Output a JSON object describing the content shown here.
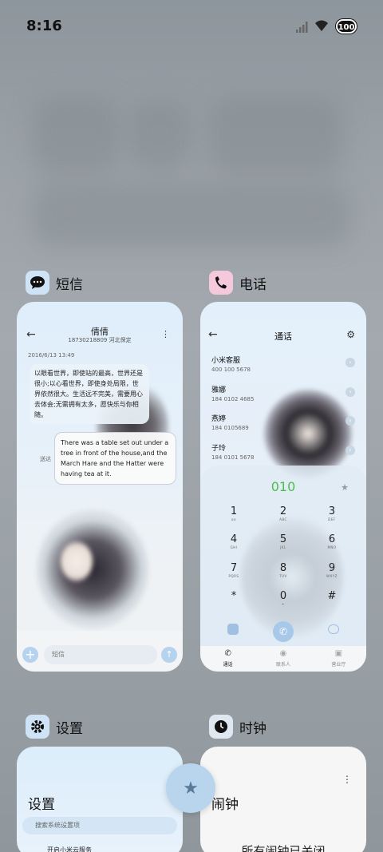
{
  "status": {
    "time": "8:16",
    "battery": "100"
  },
  "apps": {
    "sms": {
      "name": "短信",
      "contact_name": "倩倩",
      "contact_sub": "18730218809 河北保定",
      "date": "2016/6/13 13:49",
      "msg1": "以眼看世界，即使站的最高，世界还是很小;以心看世界，即使身处局限，世界依然很大。生活远不完美，需要用心去体会;无需拥有太多，愿快乐与你相随。",
      "msg2": "There was a table set out under a tree in front of the house,and the March Hare and the Hatter were having tea at it.",
      "delivered": "送达",
      "input_placeholder": "短信"
    },
    "phone": {
      "name": "电话",
      "title": "通话",
      "contacts": [
        {
          "name": "小米客服",
          "number": "400 100 5678"
        },
        {
          "name": "雅娜",
          "number": "184 0102 4685"
        },
        {
          "name": "燕婷",
          "number": "184 0105689"
        },
        {
          "name": "子玲",
          "number": "184 0101 5678"
        }
      ],
      "dialed": "010",
      "keys": [
        {
          "d": "1",
          "l": "oo"
        },
        {
          "d": "2",
          "l": "ABC"
        },
        {
          "d": "3",
          "l": "DEF"
        },
        {
          "d": "4",
          "l": "GHI"
        },
        {
          "d": "5",
          "l": "JKL"
        },
        {
          "d": "6",
          "l": "MNO"
        },
        {
          "d": "7",
          "l": "PQRS"
        },
        {
          "d": "8",
          "l": "TUV"
        },
        {
          "d": "9",
          "l": "WXYZ"
        },
        {
          "d": "*",
          "l": ""
        },
        {
          "d": "0",
          "l": "+"
        },
        {
          "d": "#",
          "l": ""
        }
      ],
      "tabs": [
        "通话",
        "联系人",
        "营业厅"
      ]
    },
    "settings": {
      "name": "设置",
      "title": "设置",
      "search_placeholder": "搜索系统设置项",
      "row1": "开启小米云服务"
    },
    "clock": {
      "name": "时钟",
      "title": "闹钟",
      "empty_text": "所有闹钟已关闭"
    }
  },
  "colors": {
    "accent": "#4bbf4b",
    "card_blue": "#dfeefb"
  }
}
